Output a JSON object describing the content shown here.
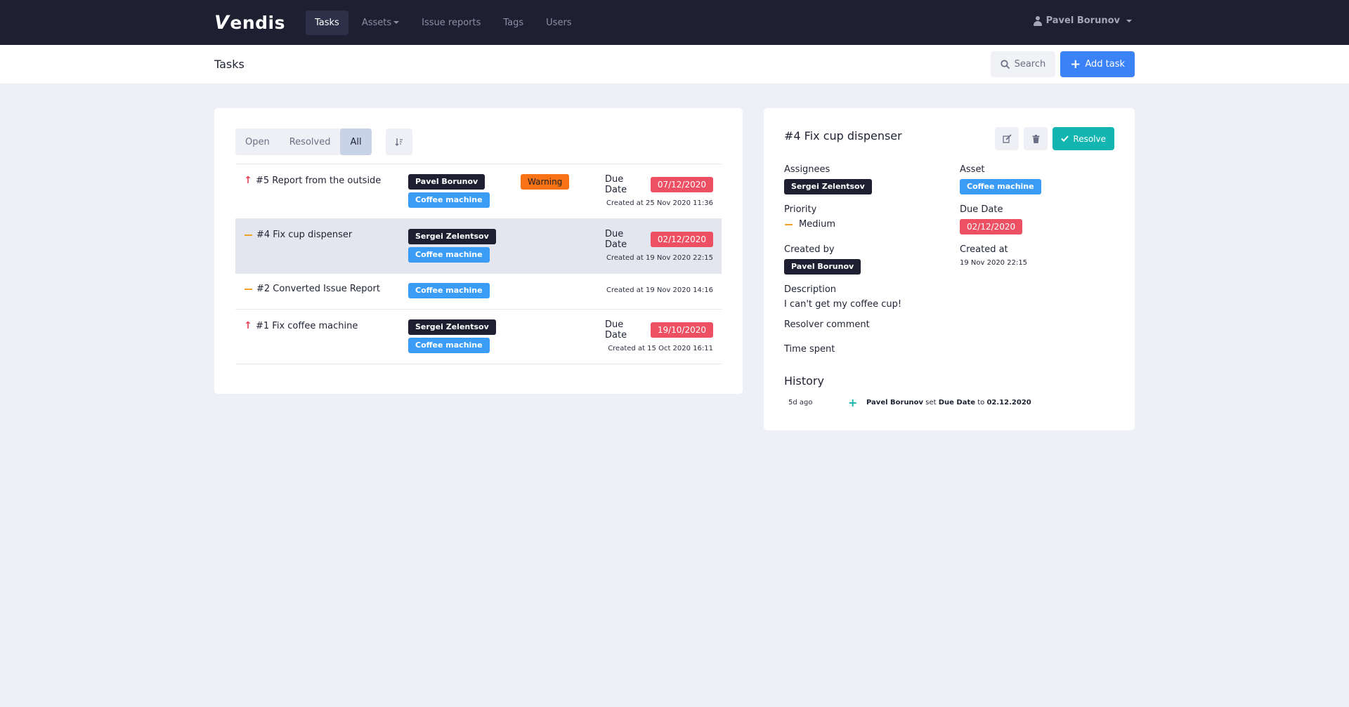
{
  "app": {
    "logo_v": "V",
    "logo_rest": "endis",
    "nav": [
      {
        "label": "Tasks",
        "active": true
      },
      {
        "label": "Assets",
        "dropdown": true
      },
      {
        "label": "Issue reports"
      },
      {
        "label": "Tags"
      },
      {
        "label": "Users"
      }
    ],
    "user_name": "Pavel Borunov"
  },
  "header": {
    "title": "Tasks",
    "search_label": "Search",
    "add_label": "Add task"
  },
  "filters": {
    "tabs": [
      "Open",
      "Resolved",
      "All"
    ],
    "active": "All"
  },
  "tasks": [
    {
      "title": "#5 Report from the outside",
      "priority": "high",
      "assignee": "Pavel Borunov",
      "asset": "Coffee machine",
      "warning": "Warning",
      "due_label": "Due Date",
      "due_date": "07/12/2020",
      "created": "Created at 25 Nov 2020 11:36"
    },
    {
      "title": "#4 Fix cup dispenser",
      "priority": "medium",
      "assignee": "Sergei Zelentsov",
      "asset": "Coffee machine",
      "due_label": "Due Date",
      "due_date": "02/12/2020",
      "created": "Created at 19 Nov 2020 22:15",
      "selected": true
    },
    {
      "title": "#2 Converted Issue Report",
      "priority": "medium",
      "asset": "Coffee machine",
      "created": "Created at 19 Nov 2020 14:16"
    },
    {
      "title": "#1 Fix coffee machine",
      "priority": "high",
      "assignee": "Sergei Zelentsov",
      "asset": "Coffee machine",
      "due_label": "Due Date",
      "due_date": "19/10/2020",
      "created": "Created at 15 Oct 2020 16:11"
    }
  ],
  "detail": {
    "title": "#4 Fix cup dispenser",
    "resolve_label": "Resolve",
    "assignees_label": "Assignees",
    "assignee": "Sergei Zelentsov",
    "asset_label": "Asset",
    "asset": "Coffee machine",
    "priority_label": "Priority",
    "priority": "Medium",
    "due_label": "Due Date",
    "due_date": "02/12/2020",
    "created_by_label": "Created by",
    "created_by": "Pavel Borunov",
    "created_at_label": "Created at",
    "created_at": "19 Nov 2020 22:15",
    "description_label": "Description",
    "description": "I can't get my coffee cup!",
    "resolver_comment_label": "Resolver comment",
    "time_spent_label": "Time spent",
    "history_label": "History",
    "history": [
      {
        "time": "5d ago",
        "user": "Pavel Borunov",
        "action": "set",
        "field": "Due Date",
        "to": "to",
        "value": "02.12.2020"
      }
    ]
  },
  "colors": {
    "nav_bg": "#1e1f30",
    "primary": "#3b82f6",
    "resolve": "#13b5b1",
    "due_badge": "#ee5063",
    "warning_badge": "#f97316",
    "priority_high": "#e8455c",
    "priority_medium": "#f0a12c"
  }
}
